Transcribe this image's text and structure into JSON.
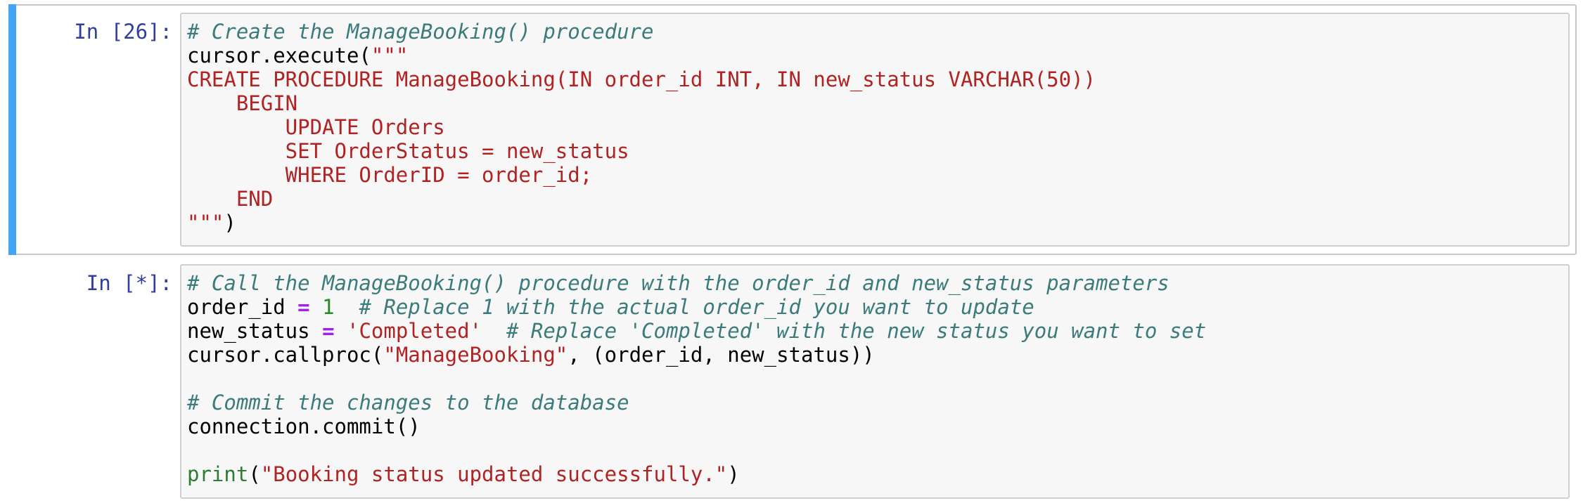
{
  "colors": {
    "selected_bar": "#42a5f5",
    "prompt": "#303f9f",
    "comment": "#3b7b7b",
    "string": "#b22222",
    "operator": "#a020f0",
    "number": "#228b22",
    "builtin": "#2e7d32"
  },
  "cells": [
    {
      "prompt": "In [26]:",
      "selected": true,
      "lines": [
        [
          {
            "t": "comment",
            "v": "# Create the ManageBooking() procedure"
          }
        ],
        [
          {
            "t": "plain",
            "v": "cursor.execute("
          },
          {
            "t": "string",
            "v": "\"\"\""
          }
        ],
        [
          {
            "t": "string",
            "v": "CREATE PROCEDURE ManageBooking(IN order_id INT, IN new_status VARCHAR(50))"
          }
        ],
        [
          {
            "t": "string",
            "v": "    BEGIN"
          }
        ],
        [
          {
            "t": "string",
            "v": "        UPDATE Orders"
          }
        ],
        [
          {
            "t": "string",
            "v": "        SET OrderStatus = new_status"
          }
        ],
        [
          {
            "t": "string",
            "v": "        WHERE OrderID = order_id;"
          }
        ],
        [
          {
            "t": "string",
            "v": "    END"
          }
        ],
        [
          {
            "t": "string",
            "v": "\"\"\""
          },
          {
            "t": "plain",
            "v": ")"
          }
        ]
      ]
    },
    {
      "prompt": "In [*]:",
      "selected": false,
      "lines": [
        [
          {
            "t": "comment",
            "v": "# Call the ManageBooking() procedure with the order_id and new_status parameters"
          }
        ],
        [
          {
            "t": "plain",
            "v": "order_id "
          },
          {
            "t": "op",
            "v": "="
          },
          {
            "t": "plain",
            "v": " "
          },
          {
            "t": "number",
            "v": "1"
          },
          {
            "t": "plain",
            "v": "  "
          },
          {
            "t": "comment",
            "v": "# Replace 1 with the actual order_id you want to update"
          }
        ],
        [
          {
            "t": "plain",
            "v": "new_status "
          },
          {
            "t": "op",
            "v": "="
          },
          {
            "t": "plain",
            "v": " "
          },
          {
            "t": "string",
            "v": "'Completed'"
          },
          {
            "t": "plain",
            "v": "  "
          },
          {
            "t": "comment",
            "v": "# Replace 'Completed' with the new status you want to set"
          }
        ],
        [
          {
            "t": "plain",
            "v": "cursor.callproc("
          },
          {
            "t": "string",
            "v": "\"ManageBooking\""
          },
          {
            "t": "plain",
            "v": ", (order_id, new_status))"
          }
        ],
        [],
        [
          {
            "t": "comment",
            "v": "# Commit the changes to the database"
          }
        ],
        [
          {
            "t": "plain",
            "v": "connection.commit()"
          }
        ],
        [],
        [
          {
            "t": "builtin",
            "v": "print"
          },
          {
            "t": "plain",
            "v": "("
          },
          {
            "t": "string",
            "v": "\"Booking status updated successfully.\""
          },
          {
            "t": "plain",
            "v": ")"
          }
        ]
      ]
    }
  ]
}
